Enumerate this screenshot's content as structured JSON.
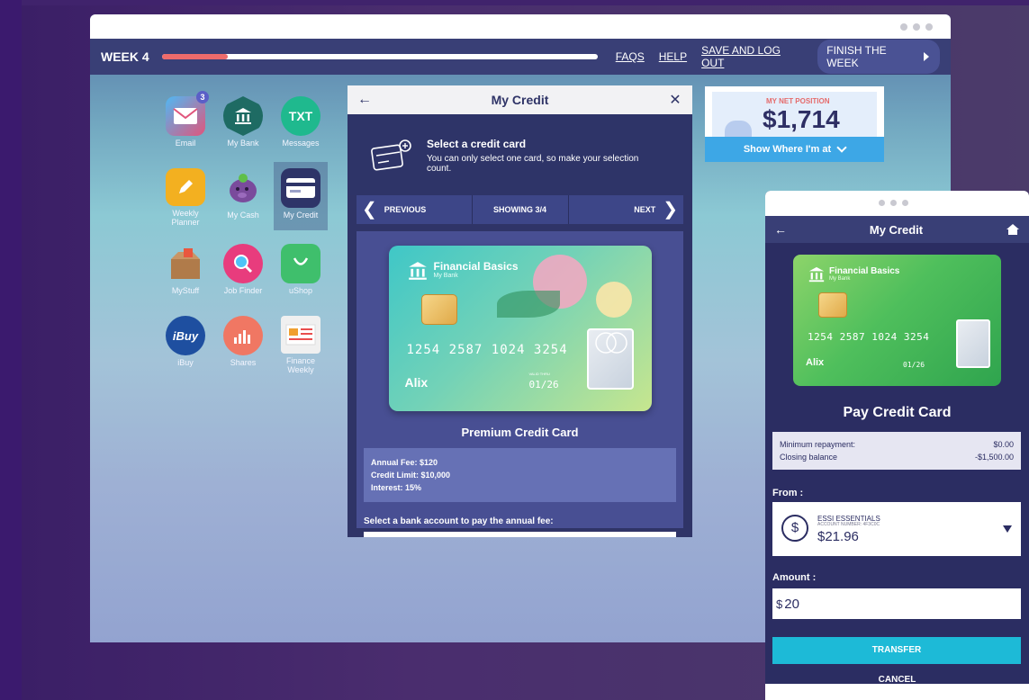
{
  "header": {
    "week_label": "WEEK 4",
    "progress": 0.15,
    "links": [
      "FAQS",
      "HELP",
      "SAVE AND LOG OUT"
    ],
    "finish_label": "FINISH THE WEEK"
  },
  "apps": [
    {
      "name": "Email",
      "icon": "envelope-icon",
      "color": "#3aa7ef",
      "badge": "3"
    },
    {
      "name": "My Bank",
      "icon": "bank-icon",
      "color": "#1e6b63"
    },
    {
      "name": "Messages",
      "icon": "txt-icon",
      "color": "#1fb98e",
      "glyph": "TXT"
    },
    {
      "name": "Weekly Planner",
      "icon": "pencil-icon",
      "color": "#f3b020"
    },
    {
      "name": "My Cash",
      "icon": "piggy-bank-icon",
      "color": "#7a4b9c"
    },
    {
      "name": "My Credit",
      "icon": "credit-card-icon",
      "color": "#2e3468",
      "selected": true
    },
    {
      "name": "MyStuff",
      "icon": "box-icon",
      "color": "#b07b4a"
    },
    {
      "name": "Job Finder",
      "icon": "magnifier-icon",
      "color": "#e83c7d"
    },
    {
      "name": "uShop",
      "icon": "shopping-bag-icon",
      "color": "#3fbf6c"
    },
    {
      "name": "iBuy",
      "icon": "ibuy-icon",
      "color": "#1e4fa0",
      "glyph": "iBuy"
    },
    {
      "name": "Shares",
      "icon": "chart-icon",
      "color": "#f07763"
    },
    {
      "name": "Finance Weekly",
      "icon": "newspaper-icon",
      "color": "#f0f0f0"
    }
  ],
  "credit_window": {
    "title": "My Credit",
    "intro_title": "Select a credit card",
    "intro_text": "You can only select one card, so make your selection count.",
    "prev_label": "PREVIOUS",
    "showing_label": "SHOWING 3/4",
    "next_label": "NEXT",
    "card": {
      "bank_name": "Financial Basics",
      "bank_sub": "My Bank",
      "number": "1254 2587 1024 3254",
      "holder": "Alix",
      "valid_label": "VALID THRU",
      "valid": "01/26"
    },
    "product_name": "Premium Credit Card",
    "terms": [
      "Annual Fee: $120",
      "Credit Limit: $10,000",
      "Interest: 15%"
    ],
    "annual_fee_prompt": "Select a bank account to pay the annual fee:"
  },
  "net_position": {
    "label": "MY NET POSITION",
    "value": "$1,714",
    "button": "Show Where I'm at"
  },
  "mobile": {
    "title": "My Credit",
    "card": {
      "bank_name": "Financial Basics",
      "bank_sub": "My Bank",
      "number": "1254 2587 1024 3254",
      "holder": "Alix",
      "valid": "01/26"
    },
    "pay_title": "Pay Credit Card",
    "min_repay_label": "Minimum repayment:",
    "min_repay_value": "$0.00",
    "closing_label": "Closing balance",
    "closing_value": "-$1,500.00",
    "from_label": "From :",
    "account_name": "ESSI ESSENTIALS",
    "account_number": "ACCOUNT NUMBER: 4F3C0C",
    "account_balance": "$21.96",
    "amount_label": "Amount :",
    "amount_currency": "$",
    "amount_value": "20",
    "transfer_label": "TRANSFER",
    "cancel_label": "CANCEL"
  }
}
